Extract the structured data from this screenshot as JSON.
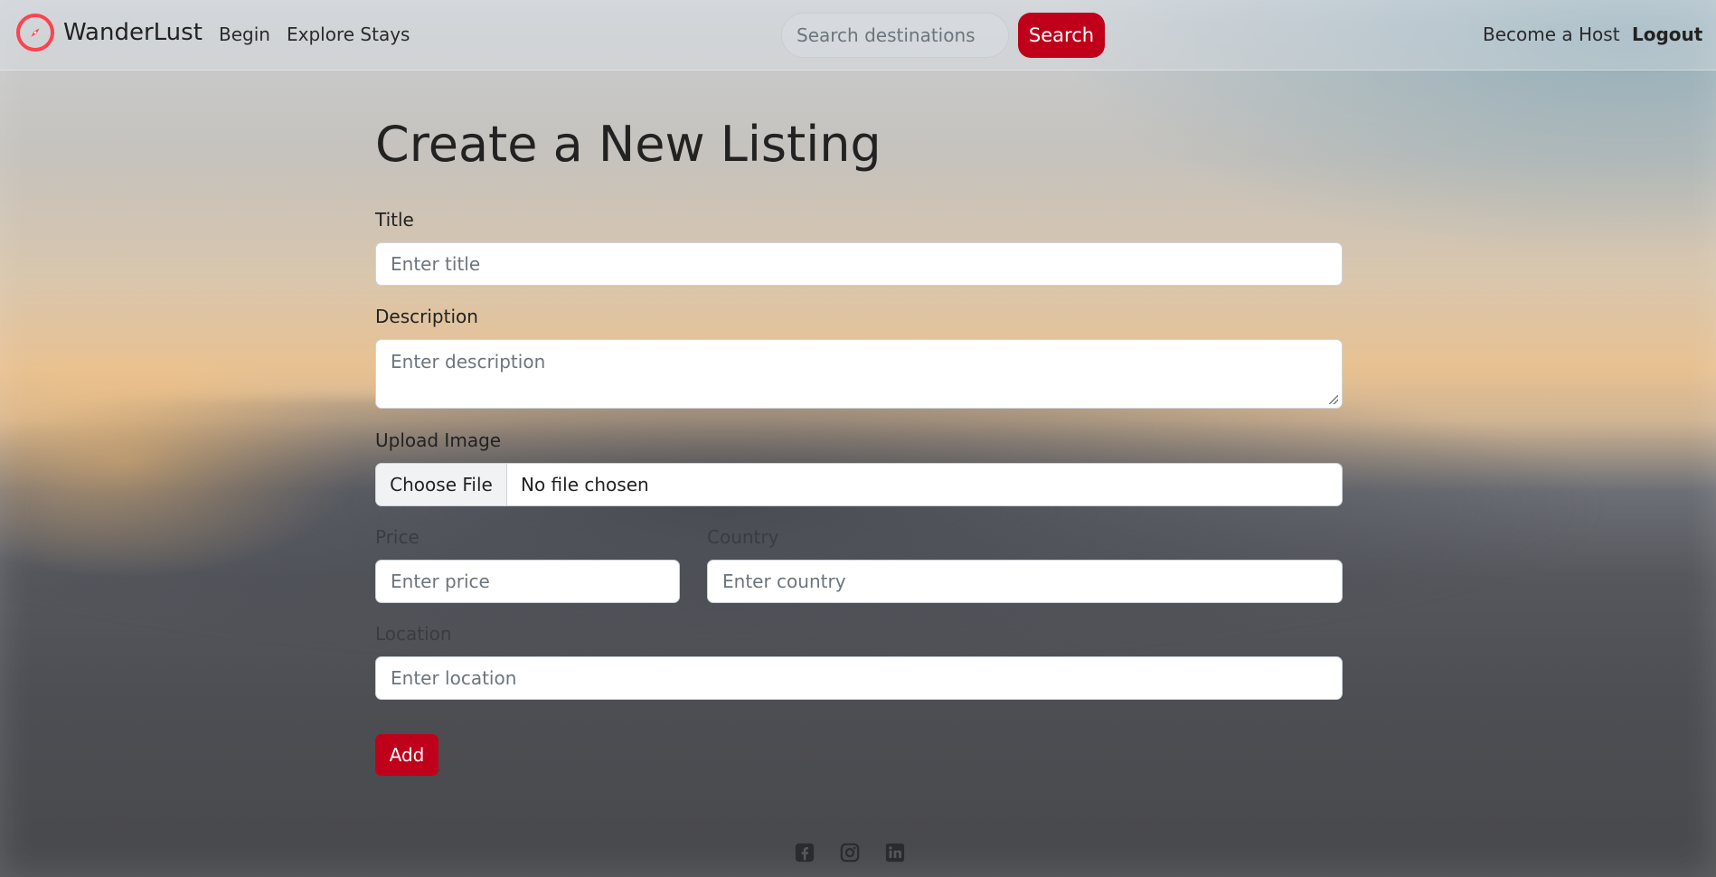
{
  "navbar": {
    "brand": "WanderLust",
    "links": [
      "Begin",
      "Explore Stays"
    ],
    "search_placeholder": "Search destinations",
    "search_button": "Search",
    "host_link": "Become a Host",
    "logout_link": "Logout"
  },
  "form": {
    "heading": "Create a New Listing",
    "title_label": "Title",
    "title_placeholder": "Enter title",
    "description_label": "Description",
    "description_placeholder": "Enter description",
    "image_label": "Upload Image",
    "file_button": "Choose File",
    "file_status": "No file chosen",
    "price_label": "Price",
    "price_placeholder": "Enter price",
    "country_label": "Country",
    "country_placeholder": "Enter country",
    "location_label": "Location",
    "location_placeholder": "Enter location",
    "submit_button": "Add"
  },
  "footer": {
    "social_icons": [
      "facebook-icon",
      "instagram-icon",
      "linkedin-icon"
    ]
  },
  "colors": {
    "brand": "#fe424d",
    "primary_button": "#c0001b"
  }
}
